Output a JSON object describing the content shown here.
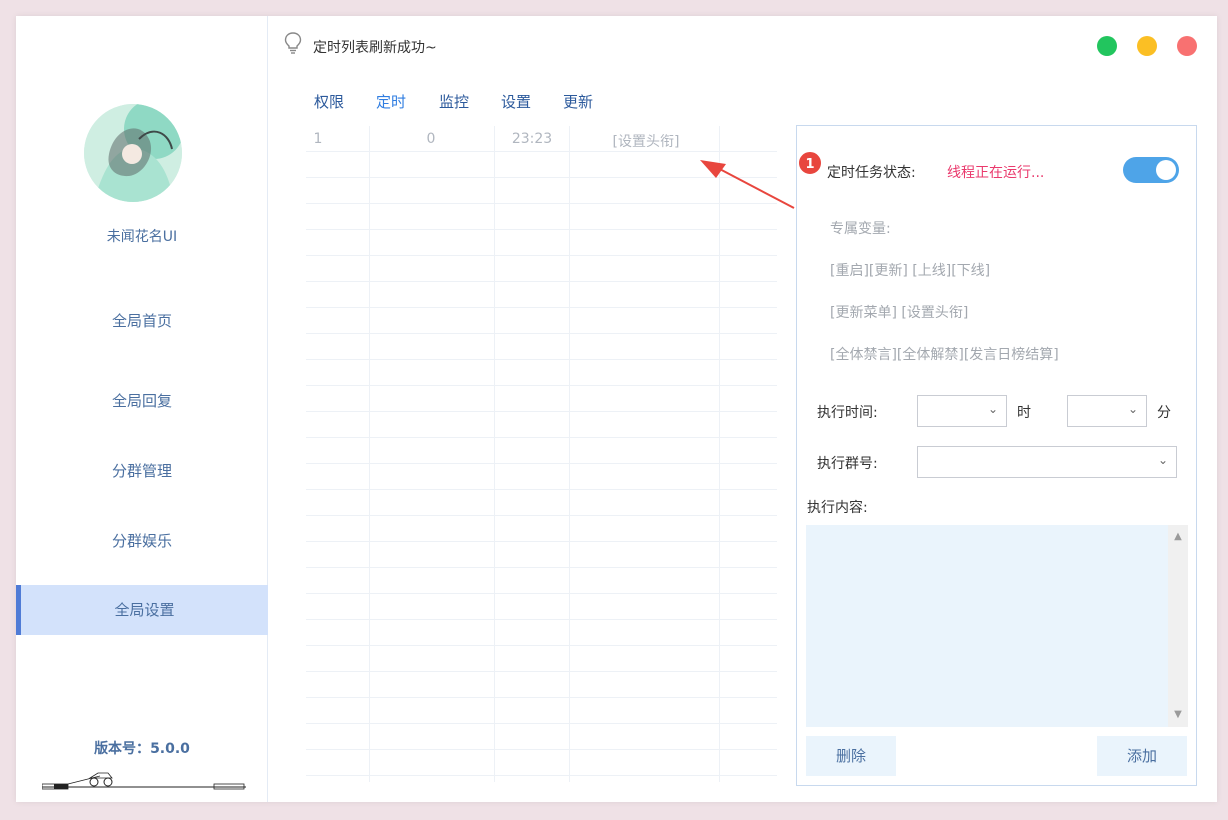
{
  "sidebar": {
    "username": "未闻花名UI",
    "nav": [
      {
        "label": "全局首页"
      },
      {
        "label": "全局回复"
      },
      {
        "label": "分群管理"
      },
      {
        "label": "分群娱乐"
      },
      {
        "label": "全局设置",
        "active": true
      }
    ],
    "version_label": "版本号：",
    "version": "5.0.0"
  },
  "topbar": {
    "status_message": "定时列表刷新成功~",
    "window_buttons": {
      "green": "#22c55e",
      "yellow": "#fbbf24",
      "red": "#f87171"
    }
  },
  "tabs": [
    {
      "label": "权限"
    },
    {
      "label": "定时",
      "active": true
    },
    {
      "label": "监控"
    },
    {
      "label": "设置"
    },
    {
      "label": "更新"
    }
  ],
  "table": {
    "rows": [
      [
        "1",
        "0",
        "23:23",
        "[设置头衔]"
      ]
    ]
  },
  "panel": {
    "badge": "1",
    "status_label": "定时任务状态:",
    "status_value": "线程正在运行...",
    "toggle_on": true,
    "hints": [
      "专属变量:",
      "[重启][更新] [上线][下线]",
      "[更新菜单] [设置头衔]",
      "[全体禁言][全体解禁][发言日榜结算]"
    ],
    "exec_time_label": "执行时间:",
    "hour_unit": "时",
    "minute_unit": "分",
    "exec_group_label": "执行群号:",
    "exec_content_label": "执行内容:",
    "delete_label": "删除",
    "add_label": "添加"
  },
  "colors": {
    "accent": "#2f7de1",
    "running": "#ea3a6d",
    "toggle": "#4ea4e8",
    "nav_active_bg": "#d3e2fb"
  }
}
